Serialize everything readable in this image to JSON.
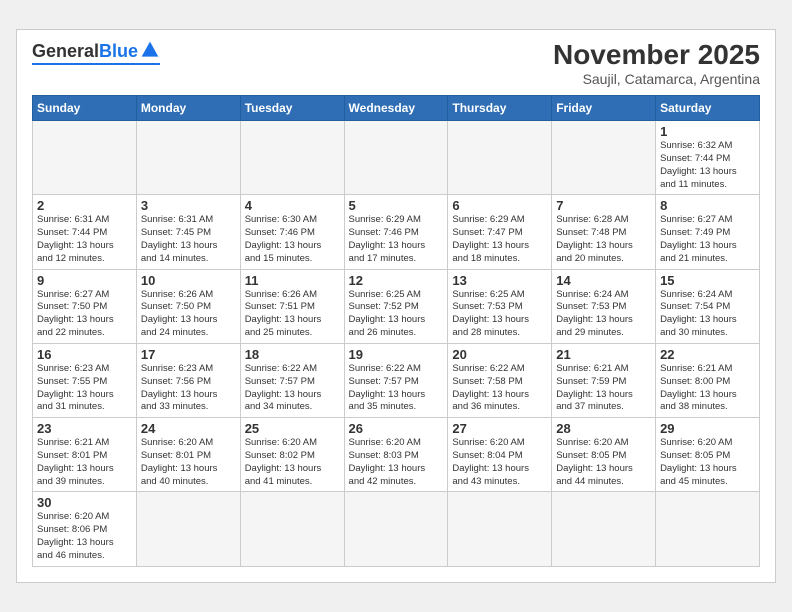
{
  "header": {
    "logo_general": "General",
    "logo_blue": "Blue",
    "month_title": "November 2025",
    "subtitle": "Saujil, Catamarca, Argentina"
  },
  "weekdays": [
    "Sunday",
    "Monday",
    "Tuesday",
    "Wednesday",
    "Thursday",
    "Friday",
    "Saturday"
  ],
  "weeks": [
    [
      {
        "day": "",
        "info": ""
      },
      {
        "day": "",
        "info": ""
      },
      {
        "day": "",
        "info": ""
      },
      {
        "day": "",
        "info": ""
      },
      {
        "day": "",
        "info": ""
      },
      {
        "day": "",
        "info": ""
      },
      {
        "day": "1",
        "info": "Sunrise: 6:32 AM\nSunset: 7:44 PM\nDaylight: 13 hours\nand 11 minutes."
      }
    ],
    [
      {
        "day": "2",
        "info": "Sunrise: 6:31 AM\nSunset: 7:44 PM\nDaylight: 13 hours\nand 12 minutes."
      },
      {
        "day": "3",
        "info": "Sunrise: 6:31 AM\nSunset: 7:45 PM\nDaylight: 13 hours\nand 14 minutes."
      },
      {
        "day": "4",
        "info": "Sunrise: 6:30 AM\nSunset: 7:46 PM\nDaylight: 13 hours\nand 15 minutes."
      },
      {
        "day": "5",
        "info": "Sunrise: 6:29 AM\nSunset: 7:46 PM\nDaylight: 13 hours\nand 17 minutes."
      },
      {
        "day": "6",
        "info": "Sunrise: 6:29 AM\nSunset: 7:47 PM\nDaylight: 13 hours\nand 18 minutes."
      },
      {
        "day": "7",
        "info": "Sunrise: 6:28 AM\nSunset: 7:48 PM\nDaylight: 13 hours\nand 20 minutes."
      },
      {
        "day": "8",
        "info": "Sunrise: 6:27 AM\nSunset: 7:49 PM\nDaylight: 13 hours\nand 21 minutes."
      }
    ],
    [
      {
        "day": "9",
        "info": "Sunrise: 6:27 AM\nSunset: 7:50 PM\nDaylight: 13 hours\nand 22 minutes."
      },
      {
        "day": "10",
        "info": "Sunrise: 6:26 AM\nSunset: 7:50 PM\nDaylight: 13 hours\nand 24 minutes."
      },
      {
        "day": "11",
        "info": "Sunrise: 6:26 AM\nSunset: 7:51 PM\nDaylight: 13 hours\nand 25 minutes."
      },
      {
        "day": "12",
        "info": "Sunrise: 6:25 AM\nSunset: 7:52 PM\nDaylight: 13 hours\nand 26 minutes."
      },
      {
        "day": "13",
        "info": "Sunrise: 6:25 AM\nSunset: 7:53 PM\nDaylight: 13 hours\nand 28 minutes."
      },
      {
        "day": "14",
        "info": "Sunrise: 6:24 AM\nSunset: 7:53 PM\nDaylight: 13 hours\nand 29 minutes."
      },
      {
        "day": "15",
        "info": "Sunrise: 6:24 AM\nSunset: 7:54 PM\nDaylight: 13 hours\nand 30 minutes."
      }
    ],
    [
      {
        "day": "16",
        "info": "Sunrise: 6:23 AM\nSunset: 7:55 PM\nDaylight: 13 hours\nand 31 minutes."
      },
      {
        "day": "17",
        "info": "Sunrise: 6:23 AM\nSunset: 7:56 PM\nDaylight: 13 hours\nand 33 minutes."
      },
      {
        "day": "18",
        "info": "Sunrise: 6:22 AM\nSunset: 7:57 PM\nDaylight: 13 hours\nand 34 minutes."
      },
      {
        "day": "19",
        "info": "Sunrise: 6:22 AM\nSunset: 7:57 PM\nDaylight: 13 hours\nand 35 minutes."
      },
      {
        "day": "20",
        "info": "Sunrise: 6:22 AM\nSunset: 7:58 PM\nDaylight: 13 hours\nand 36 minutes."
      },
      {
        "day": "21",
        "info": "Sunrise: 6:21 AM\nSunset: 7:59 PM\nDaylight: 13 hours\nand 37 minutes."
      },
      {
        "day": "22",
        "info": "Sunrise: 6:21 AM\nSunset: 8:00 PM\nDaylight: 13 hours\nand 38 minutes."
      }
    ],
    [
      {
        "day": "23",
        "info": "Sunrise: 6:21 AM\nSunset: 8:01 PM\nDaylight: 13 hours\nand 39 minutes."
      },
      {
        "day": "24",
        "info": "Sunrise: 6:20 AM\nSunset: 8:01 PM\nDaylight: 13 hours\nand 40 minutes."
      },
      {
        "day": "25",
        "info": "Sunrise: 6:20 AM\nSunset: 8:02 PM\nDaylight: 13 hours\nand 41 minutes."
      },
      {
        "day": "26",
        "info": "Sunrise: 6:20 AM\nSunset: 8:03 PM\nDaylight: 13 hours\nand 42 minutes."
      },
      {
        "day": "27",
        "info": "Sunrise: 6:20 AM\nSunset: 8:04 PM\nDaylight: 13 hours\nand 43 minutes."
      },
      {
        "day": "28",
        "info": "Sunrise: 6:20 AM\nSunset: 8:05 PM\nDaylight: 13 hours\nand 44 minutes."
      },
      {
        "day": "29",
        "info": "Sunrise: 6:20 AM\nSunset: 8:05 PM\nDaylight: 13 hours\nand 45 minutes."
      }
    ],
    [
      {
        "day": "30",
        "info": "Sunrise: 6:20 AM\nSunset: 8:06 PM\nDaylight: 13 hours\nand 46 minutes."
      },
      {
        "day": "",
        "info": ""
      },
      {
        "day": "",
        "info": ""
      },
      {
        "day": "",
        "info": ""
      },
      {
        "day": "",
        "info": ""
      },
      {
        "day": "",
        "info": ""
      },
      {
        "day": "",
        "info": ""
      }
    ]
  ]
}
